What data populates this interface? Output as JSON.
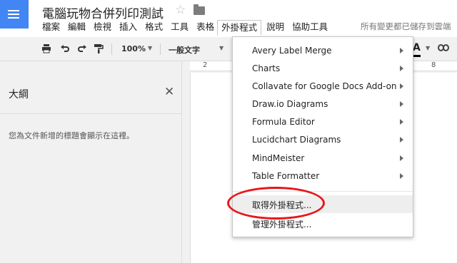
{
  "header": {
    "doc_title": "電腦玩物合併列印測試",
    "save_status": "所有變更都已儲存到雲端"
  },
  "menubar": {
    "items": [
      "檔案",
      "編輯",
      "檢視",
      "插入",
      "格式",
      "工具",
      "表格",
      "外掛程式",
      "說明",
      "協助工具"
    ],
    "active": "外掛程式"
  },
  "toolbar": {
    "zoom": "100%",
    "style": "一般文字",
    "text_color_label": "A"
  },
  "ruler": {
    "labels": [
      "2",
      "8"
    ]
  },
  "outline": {
    "title": "大綱",
    "hint": "您為文件新增的標題會顯示在這裡。"
  },
  "addons_menu": {
    "items": [
      "Avery Label Merge",
      "Charts",
      "Collavate for Google Docs Add-on",
      "Draw.io Diagrams",
      "Formula Editor",
      "Lucidchart Diagrams",
      "MindMeister",
      "Table Formatter"
    ],
    "get_addons": "取得外掛程式...",
    "manage_addons": "管理外掛程式..."
  },
  "colors": {
    "app_blue": "#4285f4",
    "highlight_red": "#e8161b"
  },
  "icons": [
    "docs-app-icon",
    "star-icon",
    "folder-icon",
    "print-icon",
    "undo-icon",
    "redo-icon",
    "paint-format-icon",
    "link-icon",
    "close-icon"
  ]
}
